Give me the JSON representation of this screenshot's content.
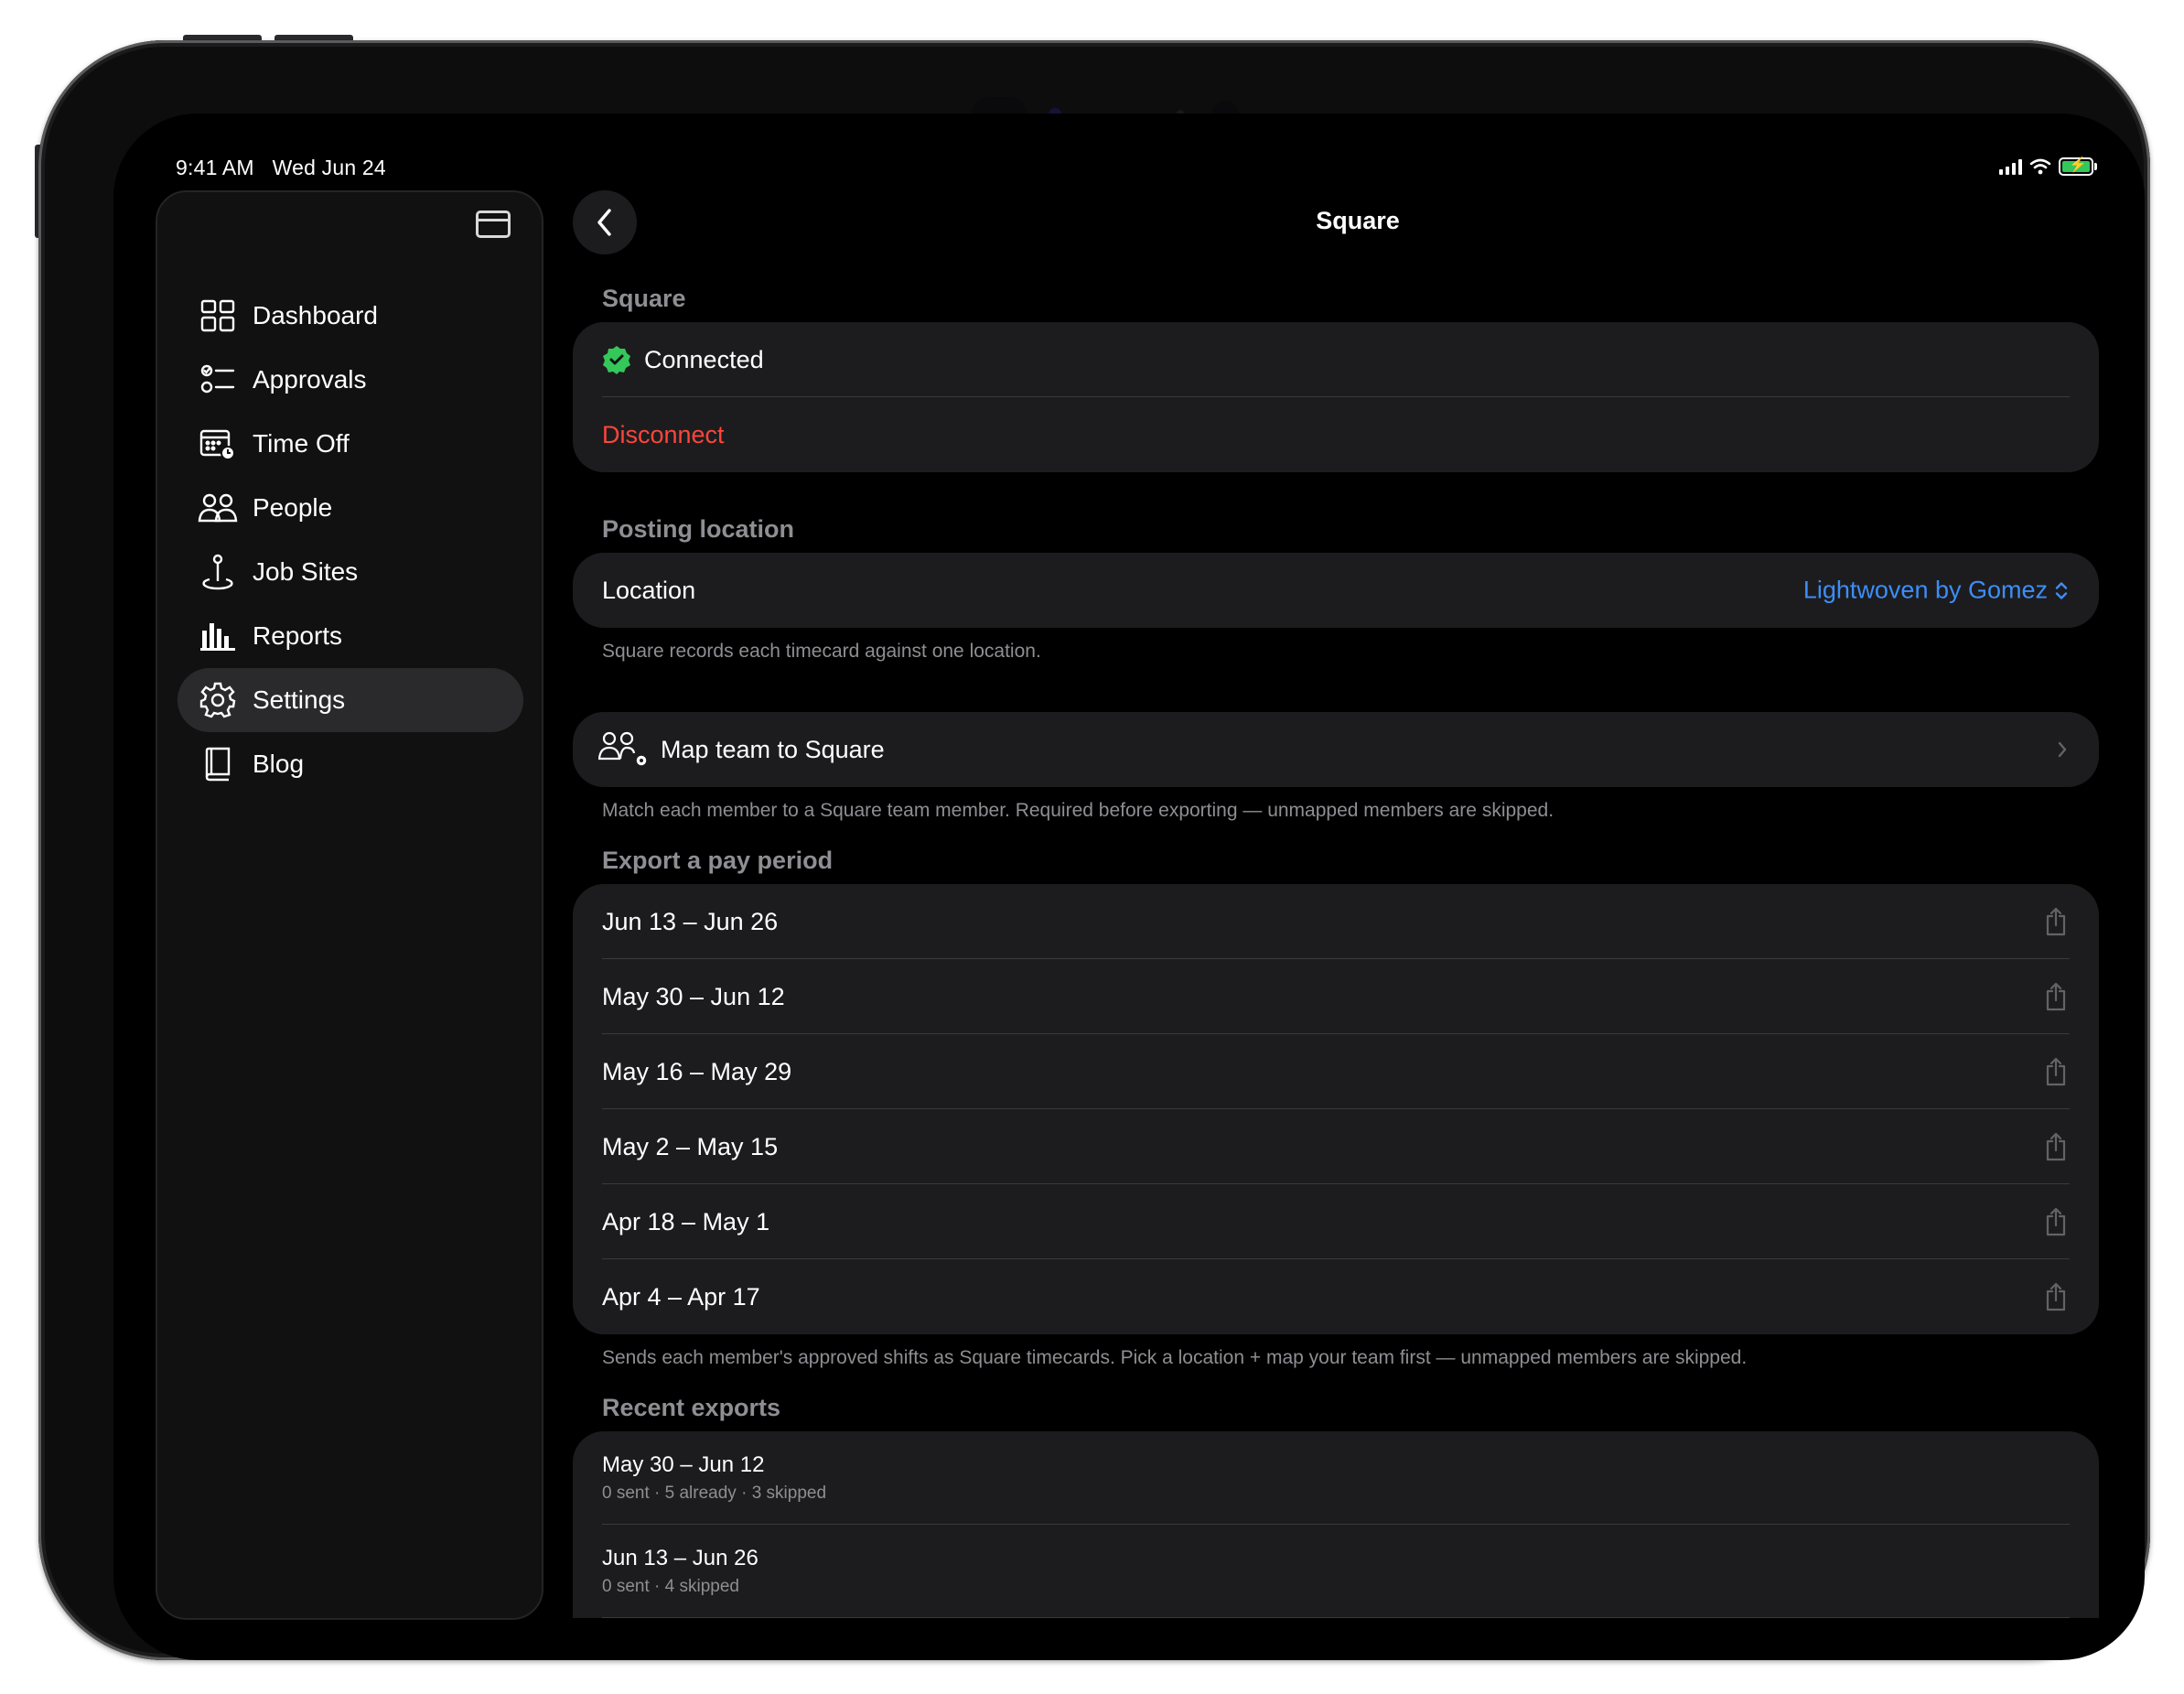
{
  "status_bar": {
    "time": "9:41 AM",
    "date": "Wed Jun 24"
  },
  "sidebar": {
    "items": [
      {
        "label": "Dashboard",
        "icon": "dashboard-grid-icon"
      },
      {
        "label": "Approvals",
        "icon": "approvals-checklist-icon"
      },
      {
        "label": "Time Off",
        "icon": "calendar-clock-icon"
      },
      {
        "label": "People",
        "icon": "people-icon"
      },
      {
        "label": "Job Sites",
        "icon": "map-pin-icon"
      },
      {
        "label": "Reports",
        "icon": "bar-chart-icon"
      },
      {
        "label": "Settings",
        "icon": "gear-icon",
        "active": true
      },
      {
        "label": "Blog",
        "icon": "book-icon"
      }
    ]
  },
  "header": {
    "title": "Square"
  },
  "square": {
    "header": "Square",
    "status": "Connected",
    "disconnect": "Disconnect"
  },
  "posting": {
    "header": "Posting location",
    "label": "Location",
    "value": "Lightwoven by Gomez",
    "footer": "Square records each timecard against one location."
  },
  "mapping": {
    "label": "Map team to Square",
    "footer": "Match each member to a Square team member. Required before exporting — unmapped members are skipped."
  },
  "export": {
    "header": "Export a pay period",
    "periods": [
      "Jun 13 – Jun 26",
      "May 30 – Jun 12",
      "May 16 – May 29",
      "May 2 – May 15",
      "Apr 18 – May 1",
      "Apr 4 – Apr 17"
    ],
    "footer": "Sends each member's approved shifts as Square timecards. Pick a location + map your team first — unmapped members are skipped."
  },
  "recent": {
    "header": "Recent exports",
    "items": [
      {
        "period": "May 30 – Jun 12",
        "detail": "0 sent · 5 already · 3 skipped"
      },
      {
        "period": "Jun 13 – Jun 26",
        "detail": "0 sent · 4 skipped"
      }
    ]
  },
  "colors": {
    "accent": "#3d8ef7",
    "destructive": "#ff453a",
    "success": "#34c759",
    "background": "#000000",
    "card": "#1c1c1e",
    "secondary_text": "#8e8e93"
  }
}
